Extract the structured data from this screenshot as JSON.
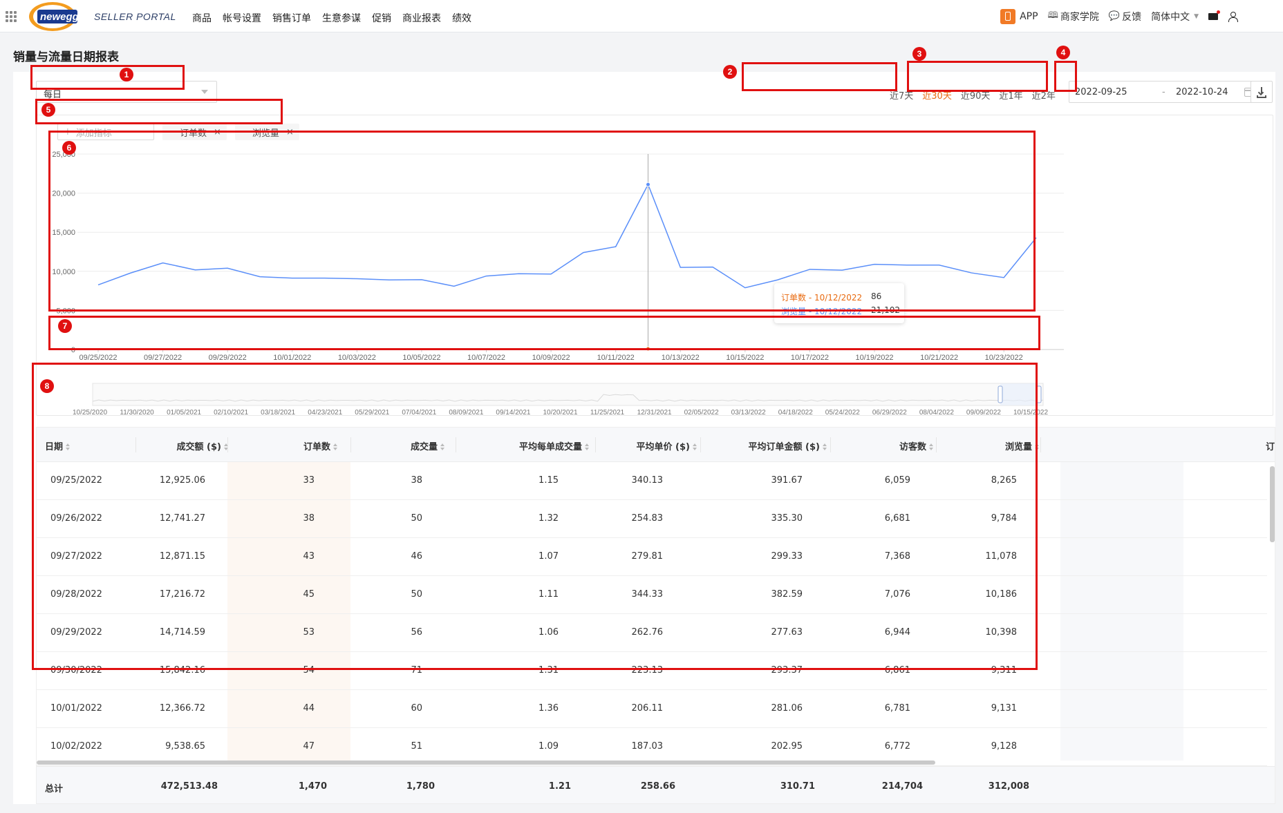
{
  "nav": {
    "brand": "SELLER PORTAL",
    "menu": [
      "商品",
      "帐号设置",
      "销售订单",
      "生意参谋",
      "促销",
      "商业报表",
      "绩效"
    ],
    "app_label": "APP",
    "academy_label": "商家学院",
    "feedback_label": "反馈",
    "language": "简体中文"
  },
  "page_title": "销量与流量日期报表",
  "period_select": "每日",
  "range_tabs": [
    {
      "label": "近7天",
      "active": false
    },
    {
      "label": "近30天",
      "active": true
    },
    {
      "label": "近90天",
      "active": false
    },
    {
      "label": "近1年",
      "active": false
    },
    {
      "label": "近2年",
      "active": false
    }
  ],
  "date_start": "2022-09-25",
  "date_sep": "-",
  "date_end": "2022-10-24",
  "add_metric_placeholder": "添加指标",
  "metric_tags": [
    {
      "label": "订单数",
      "color": "#e86a10"
    },
    {
      "label": "浏览量",
      "color": "#5b8ff9"
    }
  ],
  "tooltip": {
    "orders_label": "订单数 - 10/12/2022",
    "orders_value": "86",
    "views_label": "浏览量 - 10/12/2022",
    "views_value": "21,102"
  },
  "chart_data": {
    "type": "line",
    "y_ticks": [
      "0",
      "5,000",
      "10,000",
      "15,000",
      "20,000",
      "25,000"
    ],
    "ylim": [
      0,
      25000
    ],
    "x_tick_labels": [
      "09/25/2022",
      "09/27/2022",
      "09/29/2022",
      "10/01/2022",
      "10/03/2022",
      "10/05/2022",
      "10/07/2022",
      "10/09/2022",
      "10/11/2022",
      "10/13/2022",
      "10/15/2022",
      "10/17/2022",
      "10/19/2022",
      "10/21/2022",
      "10/23/2022"
    ],
    "x": [
      "09/25/2022",
      "09/26/2022",
      "09/27/2022",
      "09/28/2022",
      "09/29/2022",
      "09/30/2022",
      "10/01/2022",
      "10/02/2022",
      "10/03/2022",
      "10/04/2022",
      "10/05/2022",
      "10/06/2022",
      "10/07/2022",
      "10/08/2022",
      "10/09/2022",
      "10/10/2022",
      "10/11/2022",
      "10/12/2022",
      "10/13/2022",
      "10/14/2022",
      "10/15/2022",
      "10/16/2022",
      "10/17/2022",
      "10/18/2022",
      "10/19/2022",
      "10/20/2022",
      "10/21/2022",
      "10/22/2022",
      "10/23/2022",
      "10/24/2022"
    ],
    "series": [
      {
        "name": "浏览量",
        "color": "#5b8ff9",
        "values": [
          8265,
          9784,
          11078,
          10186,
          10398,
          9311,
          9131,
          9128,
          9050,
          8900,
          8930,
          8100,
          9400,
          9700,
          9650,
          12400,
          13150,
          21102,
          10500,
          10550,
          7900,
          8900,
          10250,
          10150,
          10900,
          10800,
          10800,
          9800,
          9200,
          14300
        ]
      },
      {
        "name": "订单数",
        "color": "#e86a10",
        "values": [
          33,
          38,
          43,
          45,
          53,
          54,
          44,
          47,
          50,
          48,
          46,
          45,
          47,
          49,
          50,
          55,
          60,
          86,
          52,
          50,
          44,
          46,
          50,
          49,
          52,
          51,
          50,
          48,
          47,
          55
        ]
      }
    ],
    "highlight_index": 17,
    "brush_tick_labels": [
      "10/25/2020",
      "11/30/2020",
      "01/05/2021",
      "02/10/2021",
      "03/18/2021",
      "04/23/2021",
      "05/29/2021",
      "07/04/2021",
      "08/09/2021",
      "09/14/2021",
      "10/20/2021",
      "11/25/2021",
      "12/31/2021",
      "02/05/2022",
      "03/13/2022",
      "04/18/2022",
      "05/24/2022",
      "06/29/2022",
      "08/04/2022",
      "09/09/2022",
      "10/15/2022"
    ]
  },
  "table": {
    "headers": [
      "日期",
      "成交额 ($)",
      "订单数",
      "成交量",
      "平均每单成交量",
      "平均单价 ($)",
      "平均订单金额 ($)",
      "访客数",
      "浏览量",
      "订单转"
    ],
    "rows": [
      [
        "09/25/2022",
        "12,925.06",
        "33",
        "38",
        "1.15",
        "340.13",
        "391.67",
        "6,059",
        "8,265"
      ],
      [
        "09/26/2022",
        "12,741.27",
        "38",
        "50",
        "1.32",
        "254.83",
        "335.30",
        "6,681",
        "9,784"
      ],
      [
        "09/27/2022",
        "12,871.15",
        "43",
        "46",
        "1.07",
        "279.81",
        "299.33",
        "7,368",
        "11,078"
      ],
      [
        "09/28/2022",
        "17,216.72",
        "45",
        "50",
        "1.11",
        "344.33",
        "382.59",
        "7,076",
        "10,186"
      ],
      [
        "09/29/2022",
        "14,714.59",
        "53",
        "56",
        "1.06",
        "262.76",
        "277.63",
        "6,944",
        "10,398"
      ],
      [
        "09/30/2022",
        "15,842.16",
        "54",
        "71",
        "1.31",
        "223.13",
        "293.37",
        "6,861",
        "9,311"
      ],
      [
        "10/01/2022",
        "12,366.72",
        "44",
        "60",
        "1.36",
        "206.11",
        "281.06",
        "6,781",
        "9,131"
      ],
      [
        "10/02/2022",
        "9,538.65",
        "47",
        "51",
        "1.09",
        "187.03",
        "202.95",
        "6,772",
        "9,128"
      ]
    ],
    "totals": [
      "总计",
      "472,513.48",
      "1,470",
      "1,780",
      "1.21",
      "258.66",
      "310.71",
      "214,704",
      "312,008"
    ]
  },
  "annotations": [
    "1",
    "2",
    "3",
    "4",
    "5",
    "6",
    "7",
    "8"
  ]
}
